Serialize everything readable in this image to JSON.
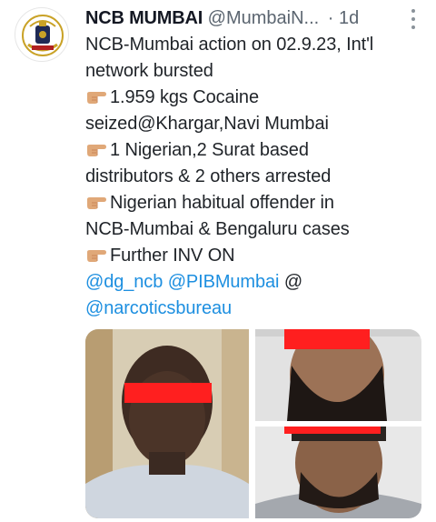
{
  "tweet": {
    "author_name": "NCB MUMBAI",
    "author_handle": "@MumbaiN...",
    "separator": "·",
    "time": "1d",
    "lines": [
      "NCB-Mumbai action on 02.9.23, Int'l",
      "network bursted",
      "1.959 kgs Cocaine",
      "seized@Khargar,Navi Mumbai",
      "1 Nigerian,2 Surat based",
      "distributors & 2 others arrested",
      "Nigerian habitual offender in",
      "NCB-Mumbai & Bengaluru cases",
      "Further INV ON"
    ],
    "mentions": {
      "dg_ncb": "@dg_ncb",
      "pib_mumbai": "@PIBMumbai",
      "at": "@",
      "narcotics": "@narcoticsbureau"
    },
    "emoji_icon": "backhand-index-pointing-right-icon",
    "photo_count": 3
  },
  "colors": {
    "link": "#1d8fe0",
    "text": "#1f2328",
    "muted": "#5b6570",
    "censor_bar": "#ff1f1f"
  }
}
